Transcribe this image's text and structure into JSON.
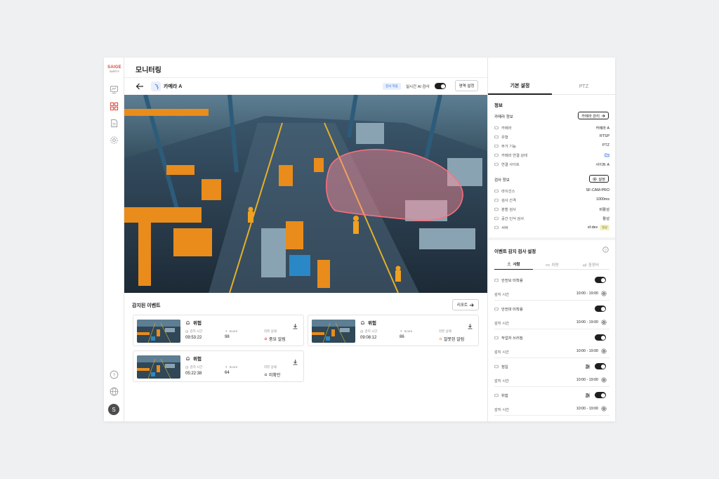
{
  "brand": {
    "logo_main": "SAIGE",
    "logo_sub": "SAFETY"
  },
  "page": {
    "title": "모니터링"
  },
  "rail": {
    "avatar_letter": "S"
  },
  "toolbar": {
    "camera_name": "카메라 A",
    "chip_label": "검사 허용",
    "ai_label": "실시간 AI 검사",
    "ai_enabled": true,
    "area_button": "영역 설정"
  },
  "events": {
    "title": "감지된 이벤트",
    "report_button": "리포트",
    "cards": [
      {
        "type": "위험",
        "time_label": "감지 시간",
        "time": "09:53:22",
        "score_label": "Score",
        "score": "98",
        "status_label": "리뷰 상태",
        "status": "중요 알림",
        "status_color": "#d9463a"
      },
      {
        "type": "위험",
        "time_label": "감지 시간",
        "time": "09:08:12",
        "score_label": "Score",
        "score": "86",
        "status_label": "리뷰 상태",
        "status": "잘못된 알림",
        "status_color": "#e6a400"
      },
      {
        "type": "위험",
        "time_label": "감지 시간",
        "time": "05:22:38",
        "score_label": "Score",
        "score": "64",
        "status_label": "리뷰 상태",
        "status": "미확인",
        "status_color": "#555555"
      }
    ]
  },
  "sidebar": {
    "tabs": [
      "기본 설정",
      "PTZ"
    ],
    "info_title": "정보",
    "camera_info_label": "카메라 정보",
    "camera_manage_button": "카메라 관리",
    "camera_rows": [
      {
        "label": "카메라",
        "value": "카메라 A",
        "icon": "camera-icon"
      },
      {
        "label": "유형",
        "value": "RTSP",
        "icon": "video-icon"
      },
      {
        "label": "부가 기능",
        "value": "PTZ",
        "icon": "globe-icon"
      },
      {
        "label": "카메라 연결 상태",
        "value": "",
        "icon": "link-icon"
      },
      {
        "label": "연결 사이트",
        "value": "사이트 A",
        "icon": "cube-icon"
      }
    ],
    "inspection_info_label": "검사 정보",
    "settings_button": "설정",
    "inspection_rows": [
      {
        "label": "라이선스",
        "value": "SF-CAM-PRO",
        "icon": "license-icon"
      },
      {
        "label": "검사 간격",
        "value": "1000ms",
        "icon": "pulse-icon"
      },
      {
        "label": "분할 검사",
        "value": "비활성",
        "icon": "split-icon"
      },
      {
        "label": "공간 인식 검사",
        "value": "활성",
        "icon": "space-icon"
      },
      {
        "label": "서버",
        "value": "sf-dev",
        "icon": "server-icon",
        "badge": "정상"
      }
    ],
    "event_settings_title": "이벤트 감지 검사 설정",
    "subtabs": [
      "사람",
      "차량",
      "중장비"
    ],
    "rules": [
      {
        "name": "안전모 미착용",
        "icon": "helmet-icon",
        "time_label": "감지 시간",
        "time": "10:00 - 19:00",
        "enabled": true,
        "filter": false
      },
      {
        "name": "안전대 미착용",
        "icon": "harness-icon",
        "time_label": "감지 시간",
        "time": "10:00 - 19:00",
        "enabled": true,
        "filter": false
      },
      {
        "name": "작업자 쓰러짐",
        "icon": "person-icon",
        "time_label": "감지 시간",
        "time": "10:00 - 19:00",
        "enabled": true,
        "filter": false
      },
      {
        "name": "침입",
        "icon": "cone-icon",
        "time_label": "감지 시간",
        "time": "10:00 - 19:00",
        "enabled": true,
        "filter": true
      },
      {
        "name": "위험",
        "icon": "bell-icon",
        "time_label": "감지 시간",
        "time": "10:00 - 19:00",
        "enabled": true,
        "filter": true
      }
    ]
  }
}
